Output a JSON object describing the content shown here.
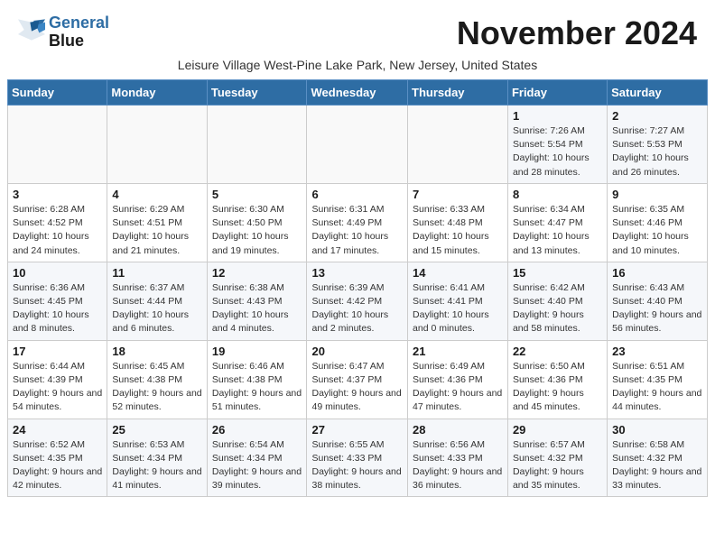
{
  "header": {
    "logo_line1": "General",
    "logo_line2": "Blue",
    "month_title": "November 2024",
    "subtitle": "Leisure Village West-Pine Lake Park, New Jersey, United States"
  },
  "days_of_week": [
    "Sunday",
    "Monday",
    "Tuesday",
    "Wednesday",
    "Thursday",
    "Friday",
    "Saturday"
  ],
  "weeks": [
    [
      {
        "day": "",
        "info": ""
      },
      {
        "day": "",
        "info": ""
      },
      {
        "day": "",
        "info": ""
      },
      {
        "day": "",
        "info": ""
      },
      {
        "day": "",
        "info": ""
      },
      {
        "day": "1",
        "info": "Sunrise: 7:26 AM\nSunset: 5:54 PM\nDaylight: 10 hours and 28 minutes."
      },
      {
        "day": "2",
        "info": "Sunrise: 7:27 AM\nSunset: 5:53 PM\nDaylight: 10 hours and 26 minutes."
      }
    ],
    [
      {
        "day": "3",
        "info": "Sunrise: 6:28 AM\nSunset: 4:52 PM\nDaylight: 10 hours and 24 minutes."
      },
      {
        "day": "4",
        "info": "Sunrise: 6:29 AM\nSunset: 4:51 PM\nDaylight: 10 hours and 21 minutes."
      },
      {
        "day": "5",
        "info": "Sunrise: 6:30 AM\nSunset: 4:50 PM\nDaylight: 10 hours and 19 minutes."
      },
      {
        "day": "6",
        "info": "Sunrise: 6:31 AM\nSunset: 4:49 PM\nDaylight: 10 hours and 17 minutes."
      },
      {
        "day": "7",
        "info": "Sunrise: 6:33 AM\nSunset: 4:48 PM\nDaylight: 10 hours and 15 minutes."
      },
      {
        "day": "8",
        "info": "Sunrise: 6:34 AM\nSunset: 4:47 PM\nDaylight: 10 hours and 13 minutes."
      },
      {
        "day": "9",
        "info": "Sunrise: 6:35 AM\nSunset: 4:46 PM\nDaylight: 10 hours and 10 minutes."
      }
    ],
    [
      {
        "day": "10",
        "info": "Sunrise: 6:36 AM\nSunset: 4:45 PM\nDaylight: 10 hours and 8 minutes."
      },
      {
        "day": "11",
        "info": "Sunrise: 6:37 AM\nSunset: 4:44 PM\nDaylight: 10 hours and 6 minutes."
      },
      {
        "day": "12",
        "info": "Sunrise: 6:38 AM\nSunset: 4:43 PM\nDaylight: 10 hours and 4 minutes."
      },
      {
        "day": "13",
        "info": "Sunrise: 6:39 AM\nSunset: 4:42 PM\nDaylight: 10 hours and 2 minutes."
      },
      {
        "day": "14",
        "info": "Sunrise: 6:41 AM\nSunset: 4:41 PM\nDaylight: 10 hours and 0 minutes."
      },
      {
        "day": "15",
        "info": "Sunrise: 6:42 AM\nSunset: 4:40 PM\nDaylight: 9 hours and 58 minutes."
      },
      {
        "day": "16",
        "info": "Sunrise: 6:43 AM\nSunset: 4:40 PM\nDaylight: 9 hours and 56 minutes."
      }
    ],
    [
      {
        "day": "17",
        "info": "Sunrise: 6:44 AM\nSunset: 4:39 PM\nDaylight: 9 hours and 54 minutes."
      },
      {
        "day": "18",
        "info": "Sunrise: 6:45 AM\nSunset: 4:38 PM\nDaylight: 9 hours and 52 minutes."
      },
      {
        "day": "19",
        "info": "Sunrise: 6:46 AM\nSunset: 4:38 PM\nDaylight: 9 hours and 51 minutes."
      },
      {
        "day": "20",
        "info": "Sunrise: 6:47 AM\nSunset: 4:37 PM\nDaylight: 9 hours and 49 minutes."
      },
      {
        "day": "21",
        "info": "Sunrise: 6:49 AM\nSunset: 4:36 PM\nDaylight: 9 hours and 47 minutes."
      },
      {
        "day": "22",
        "info": "Sunrise: 6:50 AM\nSunset: 4:36 PM\nDaylight: 9 hours and 45 minutes."
      },
      {
        "day": "23",
        "info": "Sunrise: 6:51 AM\nSunset: 4:35 PM\nDaylight: 9 hours and 44 minutes."
      }
    ],
    [
      {
        "day": "24",
        "info": "Sunrise: 6:52 AM\nSunset: 4:35 PM\nDaylight: 9 hours and 42 minutes."
      },
      {
        "day": "25",
        "info": "Sunrise: 6:53 AM\nSunset: 4:34 PM\nDaylight: 9 hours and 41 minutes."
      },
      {
        "day": "26",
        "info": "Sunrise: 6:54 AM\nSunset: 4:34 PM\nDaylight: 9 hours and 39 minutes."
      },
      {
        "day": "27",
        "info": "Sunrise: 6:55 AM\nSunset: 4:33 PM\nDaylight: 9 hours and 38 minutes."
      },
      {
        "day": "28",
        "info": "Sunrise: 6:56 AM\nSunset: 4:33 PM\nDaylight: 9 hours and 36 minutes."
      },
      {
        "day": "29",
        "info": "Sunrise: 6:57 AM\nSunset: 4:32 PM\nDaylight: 9 hours and 35 minutes."
      },
      {
        "day": "30",
        "info": "Sunrise: 6:58 AM\nSunset: 4:32 PM\nDaylight: 9 hours and 33 minutes."
      }
    ]
  ]
}
